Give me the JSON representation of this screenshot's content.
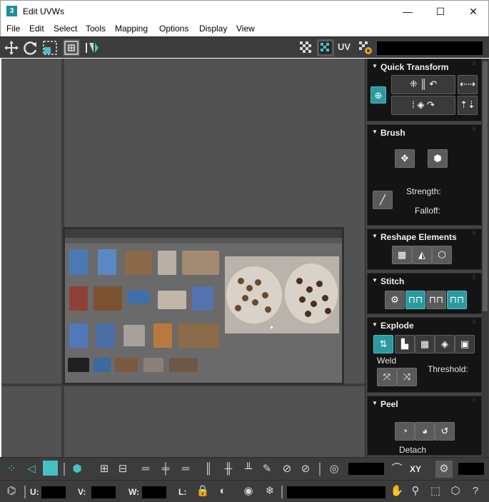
{
  "window": {
    "title": "Edit UVWs",
    "app_icon_char": "3",
    "minimize_glyph": "—",
    "maximize_glyph": "☐",
    "close_glyph": "✕"
  },
  "menu": [
    "File",
    "Edit",
    "Select",
    "Tools",
    "Mapping",
    "Options",
    "Display",
    "View"
  ],
  "toolbar_top": {
    "uv_label": "UV",
    "icons": [
      "move-icon",
      "rotate-icon",
      "scale-icon",
      "freeform-icon",
      "mirror-icon",
      "checker-icon",
      "texture-toggle-icon",
      "uv-settings-icon"
    ]
  },
  "panel": {
    "quick_transform": {
      "title": "Quick Transform"
    },
    "brush": {
      "title": "Brush",
      "strength_label": "Strength:",
      "falloff_label": "Falloff:"
    },
    "reshape": {
      "title": "Reshape Elements"
    },
    "stitch": {
      "title": "Stitch"
    },
    "explode": {
      "title": "Explode",
      "weld_label": "Weld",
      "threshold_label": "Threshold:"
    },
    "peel": {
      "title": "Peel",
      "detach_label": "Detach"
    }
  },
  "bottom_bar": {
    "xy_label": "XY",
    "u_label": "U:",
    "v_label": "V:",
    "w_label": "W:",
    "l_label": "L:"
  },
  "colors": {
    "accent": "#45c0c6",
    "panel_bg": "#141414",
    "toolbar_bg": "#3c3c3c",
    "viewport_bg": "#525252"
  }
}
